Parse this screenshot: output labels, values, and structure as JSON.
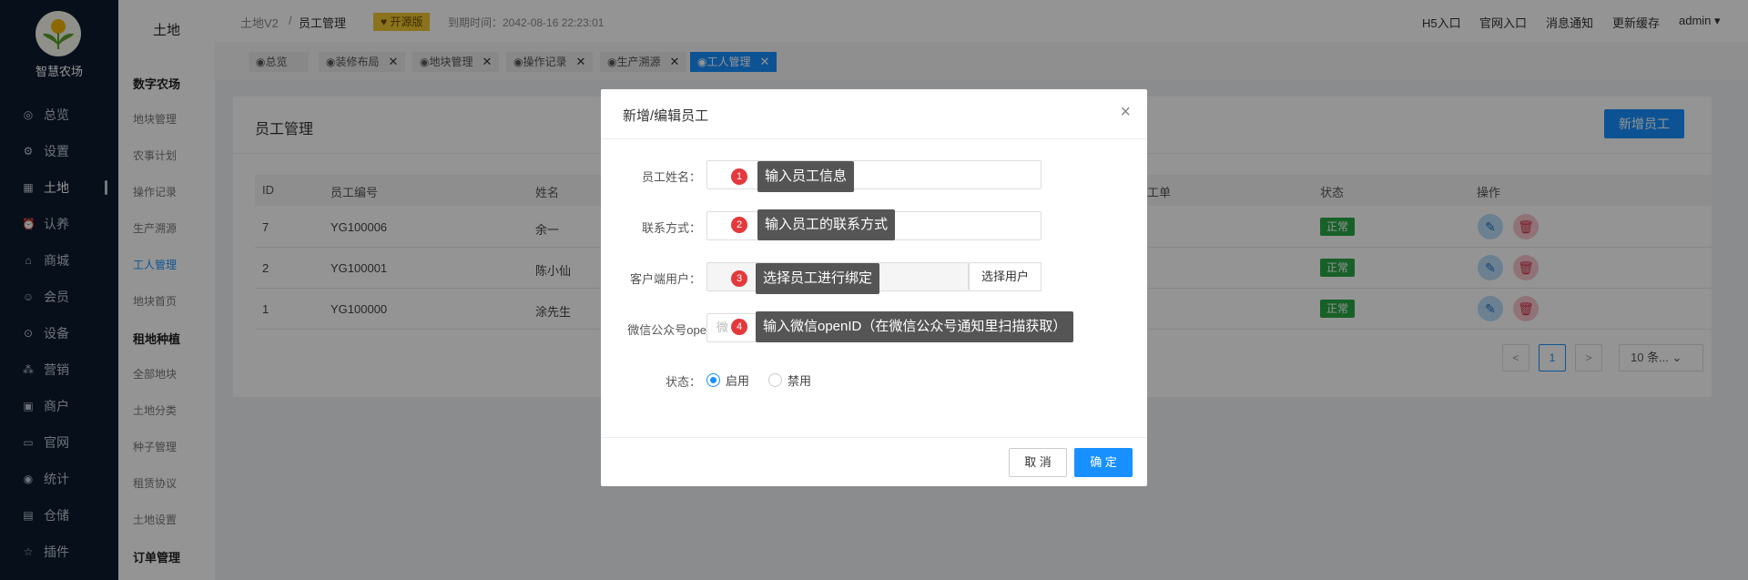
{
  "sidebar": {
    "logo_text": "智慧农场",
    "items": [
      {
        "label": "总览",
        "icon": "dashboard-icon"
      },
      {
        "label": "设置",
        "icon": "gear-icon"
      },
      {
        "label": "土地",
        "icon": "grid-icon"
      },
      {
        "label": "认养",
        "icon": "alarm-icon"
      },
      {
        "label": "商城",
        "icon": "shop-icon"
      },
      {
        "label": "会员",
        "icon": "member-icon"
      },
      {
        "label": "设备",
        "icon": "location-icon"
      },
      {
        "label": "营销",
        "icon": "apps-icon"
      },
      {
        "label": "商户",
        "icon": "store-icon"
      },
      {
        "label": "官网",
        "icon": "website-icon"
      },
      {
        "label": "统计",
        "icon": "target-icon"
      },
      {
        "label": "仓储",
        "icon": "warehouse-icon"
      },
      {
        "label": "插件",
        "icon": "star-icon"
      }
    ]
  },
  "subnav": {
    "title": "土地",
    "group1": "数字农场",
    "group1_items": [
      "地块管理",
      "农事计划",
      "操作记录",
      "生产溯源",
      "工人管理",
      "地块首页"
    ],
    "group2": "租地种植",
    "group2_items": [
      "全部地块",
      "土地分类",
      "种子管理",
      "租赁协议",
      "土地设置"
    ],
    "group3": "订单管理"
  },
  "topbar": {
    "crumb1": "土地V2",
    "sep": "/",
    "crumb2": "员工管理",
    "tag": "开源版",
    "expire": "到期时间：2042-08-16 22:23:01",
    "links": [
      "H5入口",
      "官网入口",
      "消息通知",
      "更新缓存",
      "admin"
    ]
  },
  "tabs": [
    "◉总览",
    "◉装修布局",
    "◉地块管理",
    "◉操作记录",
    "◉生产溯源",
    "◉工人管理"
  ],
  "card": {
    "title": "员工管理",
    "new_button": "新增员工",
    "headers": [
      "ID",
      "员工编号",
      "姓名",
      "工单",
      "状态",
      "操作"
    ],
    "rows": [
      {
        "id": "7",
        "code": "YG100006",
        "name": "余一",
        "status": "正常"
      },
      {
        "id": "2",
        "code": "YG100001",
        "name": "陈小仙",
        "status": "正常"
      },
      {
        "id": "1",
        "code": "YG100000",
        "name": "涂先生",
        "status": "正常"
      }
    ],
    "pager": {
      "prev": "<",
      "page": "1",
      "next": ">",
      "size": "10 条..."
    }
  },
  "dialog": {
    "title": "新增/编辑员工",
    "fields": [
      {
        "label": "员工姓名：",
        "value": ""
      },
      {
        "label": "联系方式：",
        "value": ""
      },
      {
        "label": "客户端用户：",
        "value": ""
      },
      {
        "label": "微信公众号ope",
        "placeholder": "微"
      }
    ],
    "select_user": "选择用户",
    "status_label": "状态：",
    "status_on": "启用",
    "status_off": "禁用",
    "cancel": "取 消",
    "ok": "确 定"
  },
  "tips": [
    {
      "num": "1",
      "text": "输入员工信息"
    },
    {
      "num": "2",
      "text": "输入员工的联系方式"
    },
    {
      "num": "3",
      "text": "选择员工进行绑定"
    },
    {
      "num": "4",
      "text": "输入微信openID（在微信公众号通知里扫描获取）"
    }
  ],
  "colors": {
    "primary": "#1890ff",
    "sidebar": "#0c1a2d",
    "success": "#29a745",
    "danger": "#d2344d",
    "tip_bg": "#555555"
  }
}
